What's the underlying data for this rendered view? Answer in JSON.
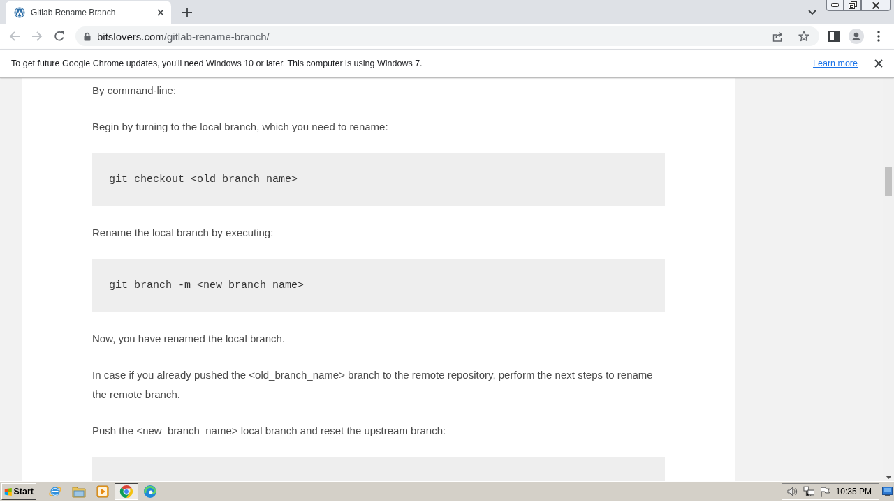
{
  "browser": {
    "tabs": [
      {
        "title": "Gitlab Rename Branch",
        "selected": true
      }
    ],
    "navigation": {
      "back_disabled": true,
      "forward_disabled": true
    },
    "address": {
      "domain": "bitslovers.com",
      "path": "/gitlab-rename-branch/"
    }
  },
  "infobar": {
    "message": "To get future Google Chrome updates, you'll need Windows 10 or later. This computer is using Windows 7.",
    "link": "Learn more"
  },
  "article": {
    "blocks": [
      {
        "kind": "paragraph",
        "text": "By command-line:"
      },
      {
        "kind": "paragraph",
        "text": "Begin by turning to the local branch, which you need to rename:"
      },
      {
        "kind": "code",
        "text": "git checkout <old_branch_name>"
      },
      {
        "kind": "paragraph",
        "text": "Rename the local branch by executing:"
      },
      {
        "kind": "code",
        "text": "git branch -m <new_branch_name>"
      },
      {
        "kind": "paragraph",
        "text": "Now, you have renamed the local branch."
      },
      {
        "kind": "paragraph",
        "text": "In case if you already pushed the <old_branch_name> branch to the remote repository, perform the next steps to rename the remote branch."
      },
      {
        "kind": "paragraph",
        "text": "Push the <new_branch_name> local branch and reset the upstream branch:"
      },
      {
        "kind": "code"
      }
    ]
  },
  "taskbar": {
    "start": "Start",
    "apps": [
      {
        "selected": false
      },
      {
        "selected": false
      },
      {
        "selected": false
      },
      {
        "selected": true
      },
      {
        "selected": false
      }
    ],
    "clock": "10:35 PM"
  }
}
